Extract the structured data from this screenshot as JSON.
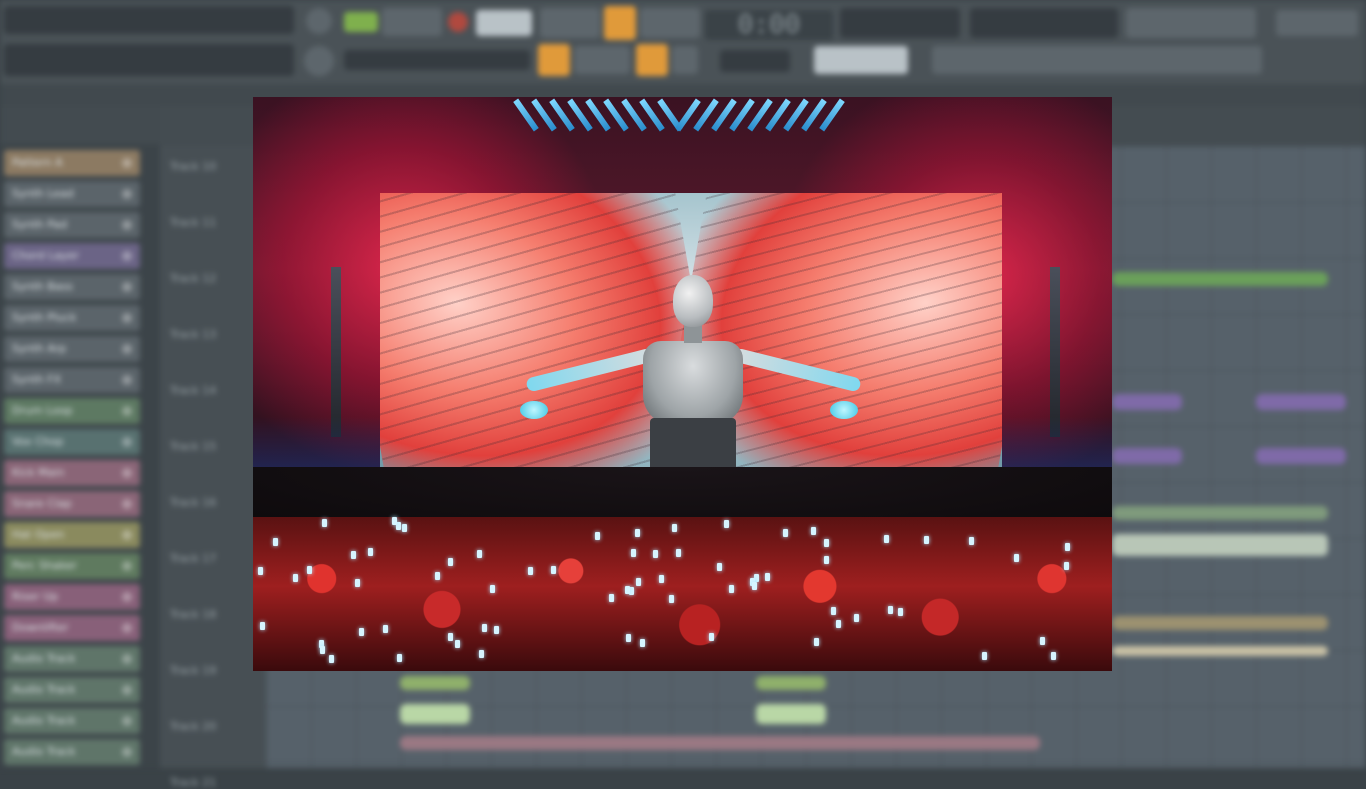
{
  "daw": {
    "time_display": "0:00",
    "browser_items": [
      {
        "label": "Pattern A",
        "color": "#8c7a62"
      },
      {
        "label": "Synth Lead",
        "color": "#5b646a"
      },
      {
        "label": "Synth Pad",
        "color": "#5b646a"
      },
      {
        "label": "Chord Layer",
        "color": "#6b6486"
      },
      {
        "label": "Synth Bass",
        "color": "#5b646a"
      },
      {
        "label": "Synth Pluck",
        "color": "#5b646a"
      },
      {
        "label": "Synth Arp",
        "color": "#5b646a"
      },
      {
        "label": "Synth FX",
        "color": "#5b646a"
      },
      {
        "label": "Drum Loop",
        "color": "#5d7962"
      },
      {
        "label": "Vox Chop",
        "color": "#587170"
      },
      {
        "label": "Kick Main",
        "color": "#8a6577"
      },
      {
        "label": "Snare Clap",
        "color": "#8a6577"
      },
      {
        "label": "Hat Open",
        "color": "#8a8a5e"
      },
      {
        "label": "Perc Shaker",
        "color": "#5f7a5f"
      },
      {
        "label": "Riser Up",
        "color": "#886079"
      },
      {
        "label": "Downlifter",
        "color": "#886079"
      },
      {
        "label": "Audio Track",
        "color": "#5f7569"
      },
      {
        "label": "Audio Track",
        "color": "#5f7569"
      },
      {
        "label": "Audio Track",
        "color": "#5f7569"
      },
      {
        "label": "Audio Track",
        "color": "#5f7569"
      }
    ],
    "track_labels": [
      {
        "label": "Track 10"
      },
      {
        "label": "Track 11"
      },
      {
        "label": "Track 12"
      },
      {
        "label": "Track 13"
      },
      {
        "label": "Track 14"
      },
      {
        "label": "Track 15"
      },
      {
        "label": "Track 16"
      },
      {
        "label": "Track 17"
      },
      {
        "label": "Track 18"
      },
      {
        "label": "Track 19"
      },
      {
        "label": "Track 20"
      },
      {
        "label": "Track 21"
      }
    ]
  },
  "photo": {
    "description_icon": "concert-photo-icon"
  }
}
